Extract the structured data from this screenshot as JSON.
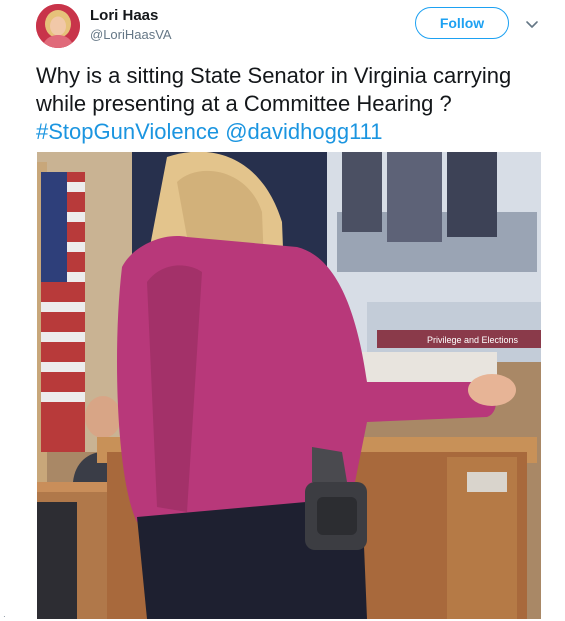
{
  "user": {
    "display_name": "Lori Haas",
    "handle": "@LoriHaasVA",
    "avatar_icon": "profile-photo"
  },
  "actions": {
    "follow_label": "Follow",
    "more_icon": "chevron-down-icon"
  },
  "tweet": {
    "text_before": "Why is a sitting State Senator in Virginia carrying while presenting at a Committee Hearing ? ",
    "hashtag": "#StopGunViolence",
    "mention": "@davidhogg111"
  },
  "photo": {
    "screen_caption": "Privilege and Elections"
  },
  "colors": {
    "accent": "#1da1f2",
    "link": "#1b95e0",
    "jacket": "#b8387a"
  }
}
